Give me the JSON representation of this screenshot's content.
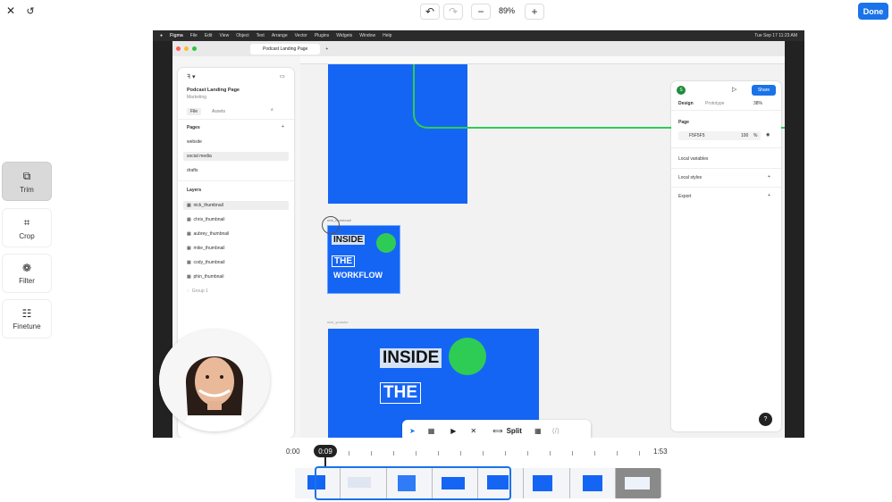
{
  "topbar": {
    "zoom": "89%",
    "done_label": "Done",
    "close_icon": "close-icon",
    "history_icon": "history-icon",
    "undo_icon": "undo-icon",
    "redo_icon": "redo-icon",
    "minus": "−",
    "plus": "+"
  },
  "tools": [
    {
      "id": "trim",
      "label": "Trim",
      "icon": "trim-icon",
      "active": true
    },
    {
      "id": "crop",
      "label": "Crop",
      "icon": "crop-icon",
      "active": false
    },
    {
      "id": "filter",
      "label": "Filter",
      "icon": "filter-icon",
      "active": false
    },
    {
      "id": "finetune",
      "label": "Finetune",
      "icon": "finetune-icon",
      "active": false
    }
  ],
  "macbar": {
    "app": "Figma",
    "menus": [
      "File",
      "Edit",
      "View",
      "Object",
      "Text",
      "Arrange",
      "Vector",
      "Plugins",
      "Widgets",
      "Window",
      "Help"
    ],
    "clock": "Tue Sep 17  11:23 AM"
  },
  "figma": {
    "tab_title": "Podcast Landing Page",
    "file_name": "Podcast Landing Page",
    "team": "Marketing",
    "panel_tabs": [
      "File",
      "Assets"
    ],
    "pages_title": "Pages",
    "pages": [
      "website",
      "social media",
      "drafts"
    ],
    "layers_title": "Layers",
    "layers": [
      "nick_thumbnail",
      "chris_thumbnail",
      "aubrey_thumbnail",
      "mike_thumbnail",
      "cody_thumbnail",
      "phin_thumbnail",
      "Group 1"
    ],
    "frame_label_1": "nick_thumbnail",
    "frame_label_2": "nick_youtube",
    "thumb_text": {
      "l1": "INSIDE",
      "l2": "THE",
      "l3": "WORKFLOW"
    },
    "big_text": {
      "l1": "INSIDE",
      "l2": "THE"
    },
    "right": {
      "share": "Share",
      "tabs": [
        "Design",
        "Prototype"
      ],
      "zoom": "38%",
      "page_title": "Page",
      "page_color": "F5F5F5",
      "opacity": "100",
      "opacity_unit": "%",
      "local_variables": "Local variables",
      "local_styles": "Local styles",
      "export": "Export"
    },
    "toolbar": {
      "split": "Split"
    }
  },
  "timeline": {
    "start": "0:00",
    "current": "0:09",
    "end": "1:53",
    "progress": 0.06
  },
  "colors": {
    "accent": "#1a73e8",
    "figma_blue": "#1565f5",
    "green": "#2ecc55"
  }
}
